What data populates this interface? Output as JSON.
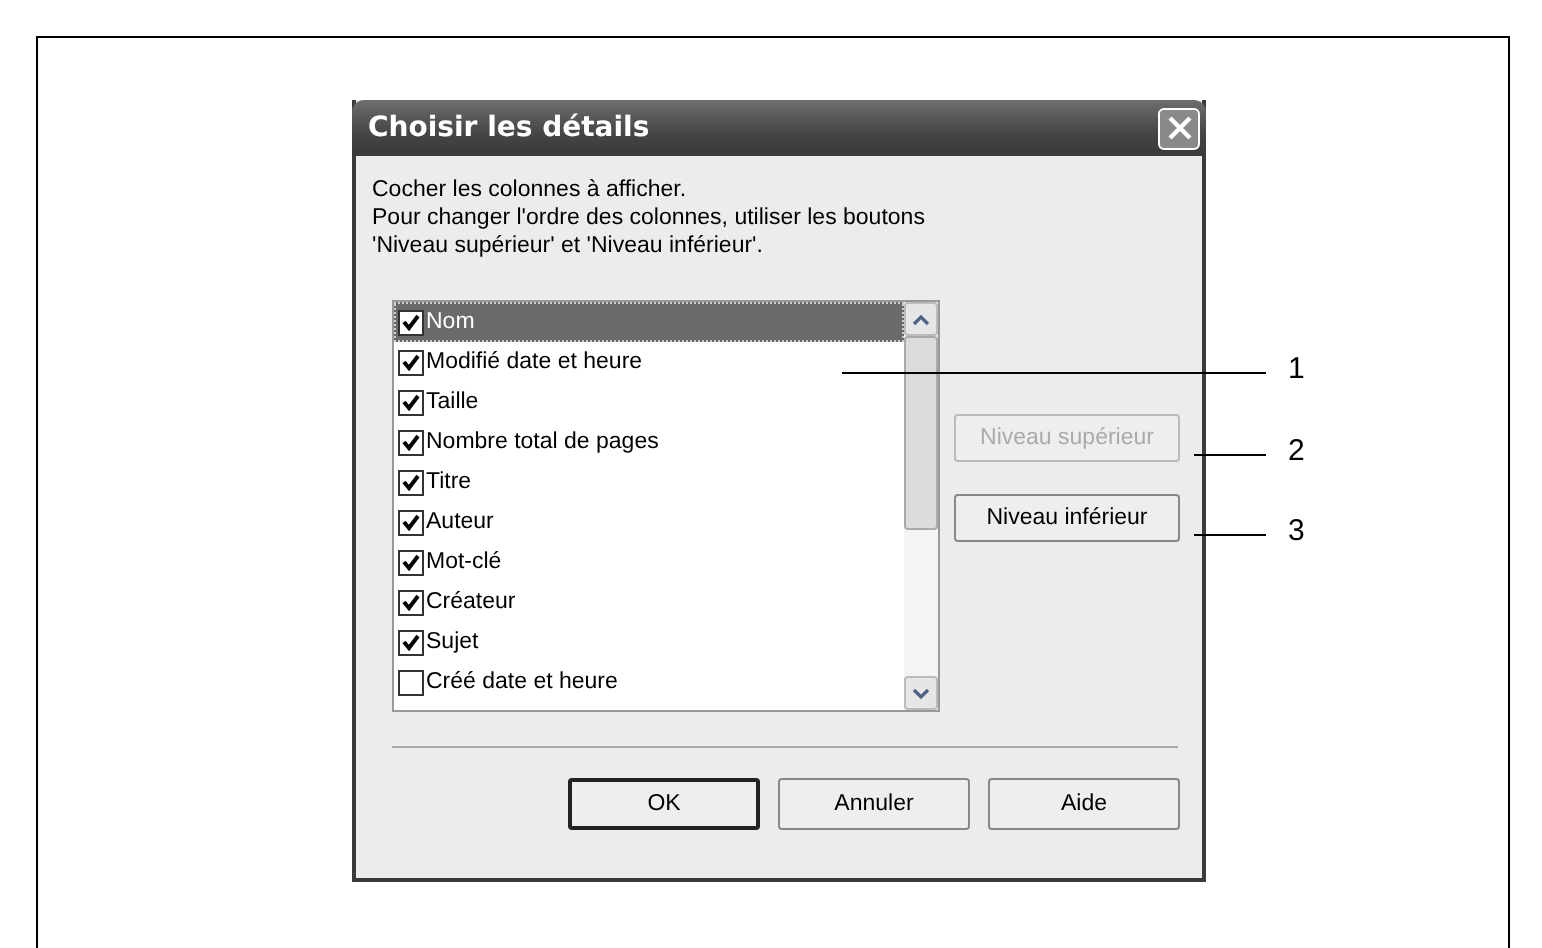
{
  "window": {
    "title": "Choisir les détails"
  },
  "instructions": [
    "Cocher les colonnes à afficher.",
    "Pour changer l'ordre des colonnes, utiliser les boutons",
    "'Niveau supérieur' et 'Niveau inférieur'."
  ],
  "columns": [
    {
      "label": "Nom",
      "checked": true,
      "selected": true
    },
    {
      "label": "Modifié date et heure",
      "checked": true,
      "selected": false
    },
    {
      "label": "Taille",
      "checked": true,
      "selected": false
    },
    {
      "label": "Nombre total de pages",
      "checked": true,
      "selected": false
    },
    {
      "label": "Titre",
      "checked": true,
      "selected": false
    },
    {
      "label": "Auteur",
      "checked": true,
      "selected": false
    },
    {
      "label": "Mot-clé",
      "checked": true,
      "selected": false
    },
    {
      "label": "Créateur",
      "checked": true,
      "selected": false
    },
    {
      "label": "Sujet",
      "checked": true,
      "selected": false
    },
    {
      "label": "Créé date et heure",
      "checked": false,
      "selected": false
    }
  ],
  "side_buttons": [
    {
      "label": "Niveau supérieur",
      "disabled": true
    },
    {
      "label": "Niveau inférieur",
      "disabled": false
    }
  ],
  "buttons": [
    {
      "label": "OK",
      "default": true
    },
    {
      "label": "Annuler",
      "default": false
    },
    {
      "label": "Aide",
      "default": false
    }
  ],
  "callouts": [
    "1",
    "2",
    "3"
  ]
}
